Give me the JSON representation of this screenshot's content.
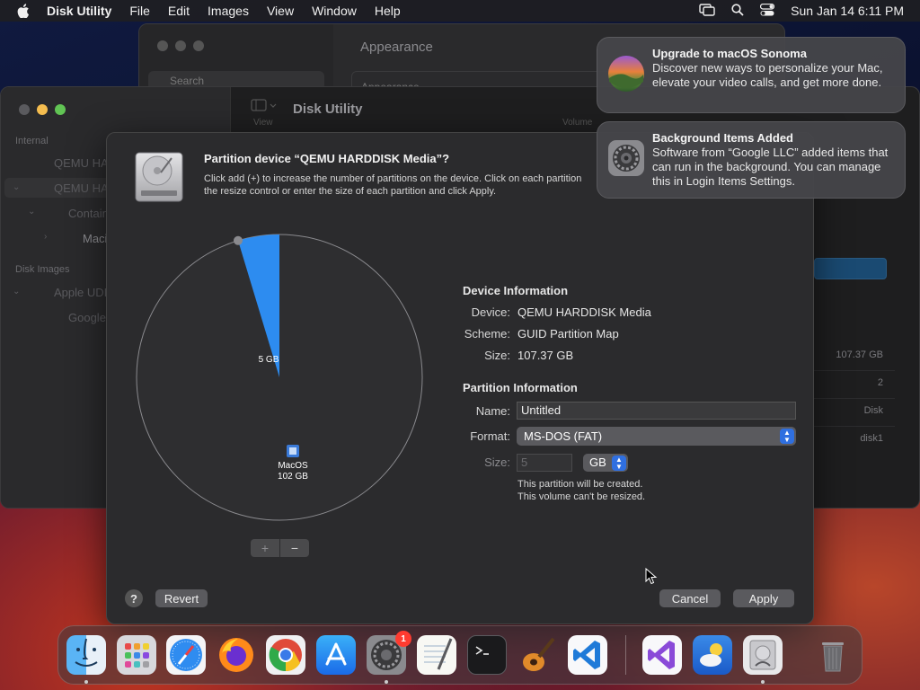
{
  "menubar": {
    "app_name": "Disk Utility",
    "items": [
      "File",
      "Edit",
      "Images",
      "View",
      "Window",
      "Help"
    ],
    "clock": "Sun Jan 14  6:11 PM"
  },
  "settings_window": {
    "title": "Appearance",
    "search_placeholder": "Search",
    "section_label": "Appearance"
  },
  "disk_utility_window": {
    "title": "Disk Utility",
    "toolbar": {
      "view_label": "View",
      "volume_label": "Volume"
    },
    "sidebar": {
      "internal_header": "Internal",
      "items": [
        "QEMU HARDDISK Media",
        "QEMU HARDDISK Media",
        "Container disk1",
        "Macintosh HD"
      ],
      "disk_images_header": "Disk Images",
      "image_items": [
        "Apple UDIF read-only Media",
        "GoogleChrome"
      ]
    },
    "info_values": [
      "107.37 GB",
      "2",
      "Disk",
      "disk1"
    ]
  },
  "sheet": {
    "title": "Partition device “QEMU HARDDISK Media”?",
    "description_line1": "Click add (+) to increase the number of partitions on the device. Click on each partition",
    "description_line2": "the resize control or enter the size of each partition and click Apply.",
    "pie": {
      "slices": [
        {
          "label": "5 GB",
          "value": 5,
          "color": "#2d8cf0"
        },
        {
          "label": "MacOS",
          "size_label": "102 GB",
          "value": 102,
          "color": "#2e2e30"
        }
      ]
    },
    "add_button": "+",
    "remove_button": "−",
    "device_info": {
      "header": "Device Information",
      "device_label": "Device:",
      "device_value": "QEMU HARDDISK Media",
      "scheme_label": "Scheme:",
      "scheme_value": "GUID Partition Map",
      "size_label": "Size:",
      "size_value": "107.37 GB"
    },
    "partition_info": {
      "header": "Partition Information",
      "name_label": "Name:",
      "name_value": "Untitled",
      "format_label": "Format:",
      "format_value": "MS-DOS (FAT)",
      "size_label": "Size:",
      "size_value": "5",
      "unit_value": "GB",
      "note_line1": "This partition will be created.",
      "note_line2": "This volume can't be resized."
    },
    "help_button": "?",
    "revert_button": "Revert",
    "cancel_button": "Cancel",
    "apply_button": "Apply"
  },
  "notifications": [
    {
      "title": "Upgrade to macOS Sonoma",
      "body": "Discover new ways to personalize your Mac, elevate your video calls, and get more done."
    },
    {
      "title": "Background Items Added",
      "body": "Software from “Google LLC” added items that can run in the background. You can manage this in Login Items Settings."
    }
  ],
  "dock": {
    "apps": [
      "Finder",
      "Launchpad",
      "Safari",
      "Firefox",
      "Chrome",
      "App Store",
      "System Settings",
      "TextEdit",
      "Terminal",
      "GarageBand",
      "Visual Studio Code",
      "Visual Studio",
      "Weather",
      "Disk Utility",
      "Trash"
    ],
    "settings_badge": "1"
  }
}
